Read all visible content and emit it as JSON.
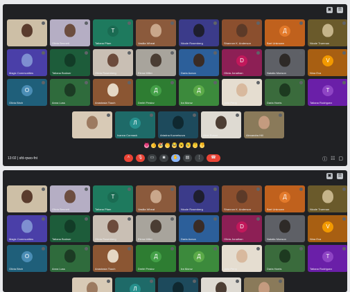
{
  "meeting": {
    "time": "13:02",
    "sep": "|",
    "code": "sfd-rpwo-fnt"
  },
  "topbar": {
    "icons": [
      "window-icon",
      "people-icon"
    ]
  },
  "tiles": [
    {
      "name": "",
      "color": "#cdbfa6",
      "type": "face",
      "face": "#5a3c2d"
    },
    {
      "name": "Olivia Bennett",
      "color": "#b5aec4",
      "type": "face",
      "face": "#6c4d3f"
    },
    {
      "name": "Tatiana Pfam",
      "color": "#1e7a5e",
      "type": "letter",
      "letter": "Т",
      "avatar": "#1a6b52"
    },
    {
      "name": "Vasilia Wheat",
      "color": "#8b5a3c",
      "type": "face",
      "face": "#c9a78b"
    },
    {
      "name": "Nicole Rosenberg",
      "color": "#3b3b8a",
      "type": "face",
      "face": "#1e1e2e"
    },
    {
      "name": "Shannon K. Anderson",
      "color": "#8b4f2e",
      "type": "face",
      "face": "#5c3a28"
    },
    {
      "name": "Bart Unknown",
      "color": "#c0611d",
      "type": "letter",
      "letter": "Д",
      "avatar": "#e37a2b"
    },
    {
      "name": "Nicole Trueman",
      "color": "#6a5a2b",
      "type": "face",
      "face": "#c5b48a"
    },
    {
      "name": "Magic Communities",
      "color": "#4a3fa8",
      "type": "face",
      "face": "#7e8fd1"
    },
    {
      "name": "Tatiana Bodwer",
      "color": "#1d5c3a",
      "type": "face",
      "face": "#123c27"
    },
    {
      "name": "Olivia Rosenberg",
      "color": "#c9bfb4",
      "type": "face",
      "face": "#6c4b3c"
    },
    {
      "name": "Elena Miller",
      "color": "#a8a49c",
      "type": "face",
      "face": "#4a3d33"
    },
    {
      "name": "Daria Azova",
      "color": "#2c5f9a",
      "type": "face",
      "face": "#3a2c26"
    },
    {
      "name": "Olivia Jonathan",
      "color": "#8d1f55",
      "type": "letter",
      "letter": "D",
      "avatar": "#c2185b"
    },
    {
      "name": "Natalia Monson",
      "color": "#5e6066",
      "type": "face",
      "face": "#2e2a27"
    },
    {
      "name": "Nina Eva",
      "color": "#a85f12",
      "type": "letter",
      "letter": "V",
      "avatar": "#f29900"
    },
    {
      "name": "Olivia Birch",
      "color": "#1f5f7a",
      "type": "letter",
      "letter": "O",
      "avatar": "#4a8db5"
    },
    {
      "name": "Anna Luss",
      "color": "#2f6b3c",
      "type": "face",
      "face": "#1c3b24"
    },
    {
      "name": "Anastasia Tkach",
      "color": "#8b5633",
      "type": "face",
      "face": "#e5d7c4"
    },
    {
      "name": "Dmitri Pestov",
      "color": "#2e7d32",
      "type": "letter",
      "letter": "Д",
      "avatar": "#43a047"
    },
    {
      "name": "Ira Moroz",
      "color": "#3c8a3c",
      "type": "letter",
      "letter": "Д",
      "avatar": "#5cab49"
    },
    {
      "name": "Julia Perry",
      "color": "#e5ddd0",
      "type": "face",
      "face": "#d8b99e"
    },
    {
      "name": "Daria Harris",
      "color": "#3a6b3c",
      "type": "face",
      "face": "#1d3a20"
    },
    {
      "name": "Tatiana Rodriguez",
      "color": "#6a1fa8",
      "type": "letter",
      "letter": "Т",
      "avatar": "#8e44c4"
    }
  ],
  "row5": [
    {
      "name": "",
      "color": "#d8cab6",
      "type": "face",
      "face": "#9c7a60"
    },
    {
      "name": "Ivanna Cormack",
      "color": "#1e6a68",
      "type": "letter",
      "letter": "Л",
      "avatar": "#27908d"
    },
    {
      "name": "Ariadna Kuznetsova",
      "color": "#1d4a5c",
      "type": "face",
      "face": "#0f2830"
    },
    {
      "name": "Alice Russo",
      "color": "#dedad2",
      "type": "face",
      "face": "#4c3d33"
    },
    {
      "name": "Alexandra Hill",
      "color": "#8a7a5a",
      "type": "face",
      "face": "#c49b7f"
    }
  ],
  "reactions": [
    "💗",
    "👍",
    "🎉",
    "👏",
    "😂",
    "😮",
    "😢",
    "🤔",
    "👎"
  ],
  "controls": [
    "arrow-icon",
    "mic-off-icon",
    "cam-icon",
    "cc-icon",
    "raise-icon",
    "present-icon",
    "more-icon",
    "end-call-icon"
  ]
}
